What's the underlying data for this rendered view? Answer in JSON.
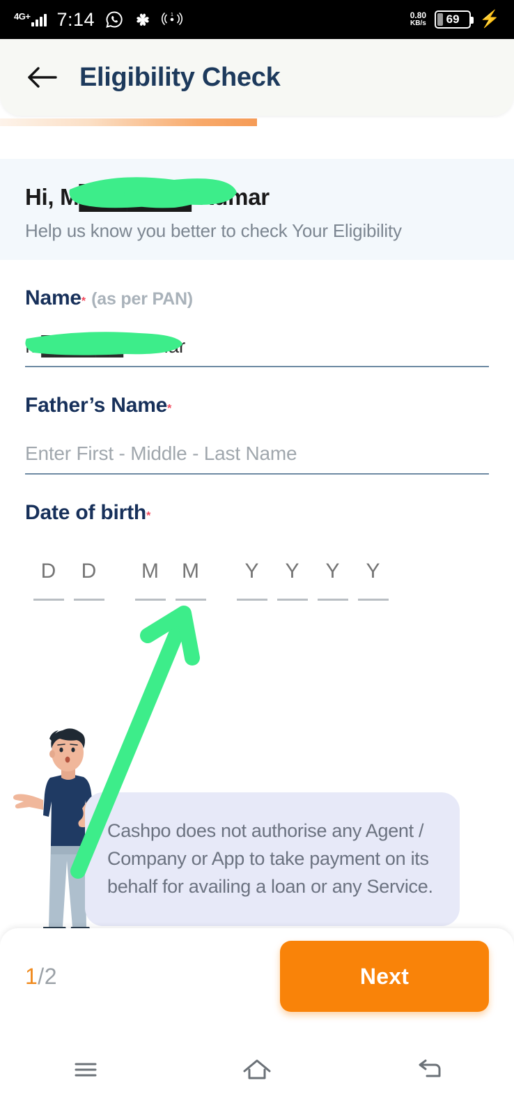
{
  "statusbar": {
    "network_label": "4G+",
    "time": "7:14",
    "whatsapp_icon": "whatsapp-icon",
    "apps_icon": "apps-icon",
    "hotspot_icon": "hotspot-icon",
    "data_rate_value": "0.80",
    "data_rate_unit": "KB/s",
    "battery_percent": "69",
    "charging_icon": "charging-bolt-icon"
  },
  "header": {
    "back_icon": "back-arrow-icon",
    "title": "Eligibility Check"
  },
  "progress": {
    "percent": 50
  },
  "greeting": {
    "title": "Hi, M███████ Kumar",
    "subtitle": "Help us know you better to check Your Eligibility"
  },
  "form": {
    "name": {
      "label": "Name",
      "required_mark": "*",
      "hint": "(as per PAN)",
      "value": "M██████ Kumar",
      "placeholder": "Enter First - Middle - Last Name"
    },
    "fathers_name": {
      "label": "Father’s Name",
      "required_mark": "*",
      "value": "",
      "placeholder": "Enter First - Middle - Last Name"
    },
    "dob": {
      "label": "Date of birth",
      "required_mark": "*",
      "day": [
        "D",
        "D"
      ],
      "month": [
        "M",
        "M"
      ],
      "year": [
        "Y",
        "Y",
        "Y",
        "Y"
      ]
    }
  },
  "notice": {
    "text": "Cashpo does not authorise any Agent / Company or App to take payment on its behalf for availing a loan or any Service."
  },
  "bottom": {
    "page_current": "1",
    "page_separator": "/",
    "page_total": "2",
    "next_label": "Next"
  },
  "navbar": {
    "recents_icon": "menu-icon",
    "home_icon": "home-icon",
    "back_icon": "back-nav-icon"
  },
  "annotations": {
    "highlight_color": "#3ded8a",
    "arrow_target": "month-field"
  },
  "colors": {
    "accent_orange": "#f98309",
    "title_navy": "#1d3a5c",
    "required_red": "#f2495c",
    "notice_bg": "#e7e9f8",
    "greeting_bg": "#f3f8fc",
    "header_bg": "#f7f8f4"
  }
}
